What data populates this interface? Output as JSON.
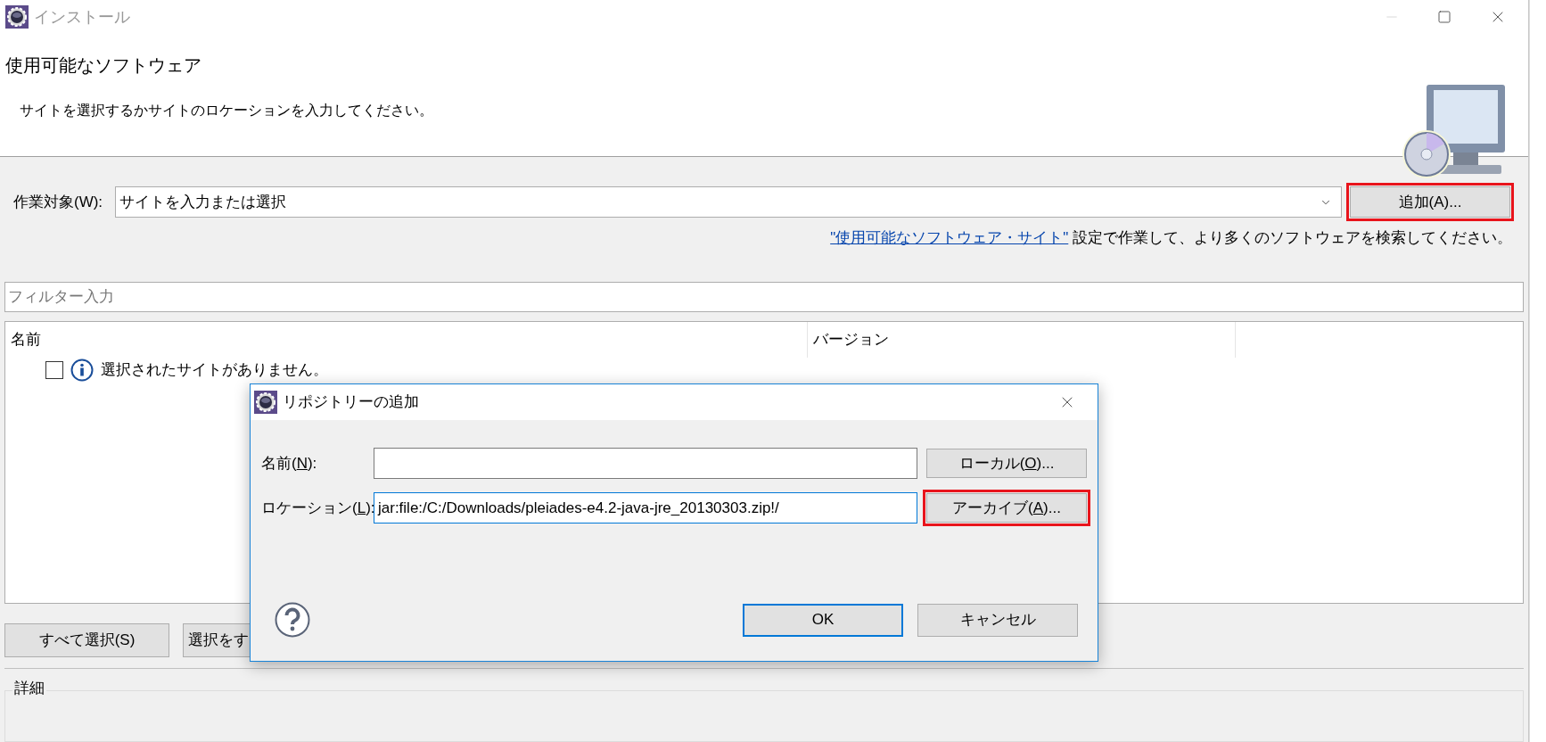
{
  "window": {
    "title": "インストール"
  },
  "header": {
    "title": "使用可能なソフトウェア",
    "description": "サイトを選択するかサイトのロケーションを入力してください。"
  },
  "work_with": {
    "label": "作業対象(W):",
    "value": "サイトを入力または選択",
    "add_button": {
      "label": "追加(A)...",
      "highlighted": true
    }
  },
  "hint": {
    "link": "\"使用可能なソフトウェア・サイト\"",
    "text": " 設定で作業して、より多くのソフトウェアを検索してください。"
  },
  "filter": {
    "placeholder": "フィルター入力"
  },
  "table": {
    "columns": [
      "名前",
      "バージョン"
    ],
    "rows": [
      {
        "checked": false,
        "text": "選択されたサイトがありません。"
      }
    ]
  },
  "buttons": [
    "すべて選択(S)",
    "選択をす"
  ],
  "details": {
    "title": "詳細"
  },
  "dialog": {
    "title": "リポジトリーの追加",
    "fields": [
      {
        "label_pre": "名前(",
        "mnemonic": "N",
        "label_post": "):",
        "focused": false,
        "button": {
          "label_pre": "ローカル(",
          "mnemonic": "O",
          "label_post": ")...",
          "highlighted": false
        }
      },
      {
        "label_pre": "ロケーション(",
        "mnemonic": "L",
        "label_post": "):",
        "value": "jar:file:/C:/Downloads/pleiades-e4.2-java-jre_20130303.zip!/",
        "focused": true,
        "button": {
          "label_pre": "アーカイブ(",
          "mnemonic": "A",
          "label_post": ")...",
          "highlighted": true
        }
      }
    ],
    "buttons": [
      {
        "label": "OK",
        "default": true
      },
      {
        "label": "キャンセル",
        "default": false
      }
    ]
  }
}
